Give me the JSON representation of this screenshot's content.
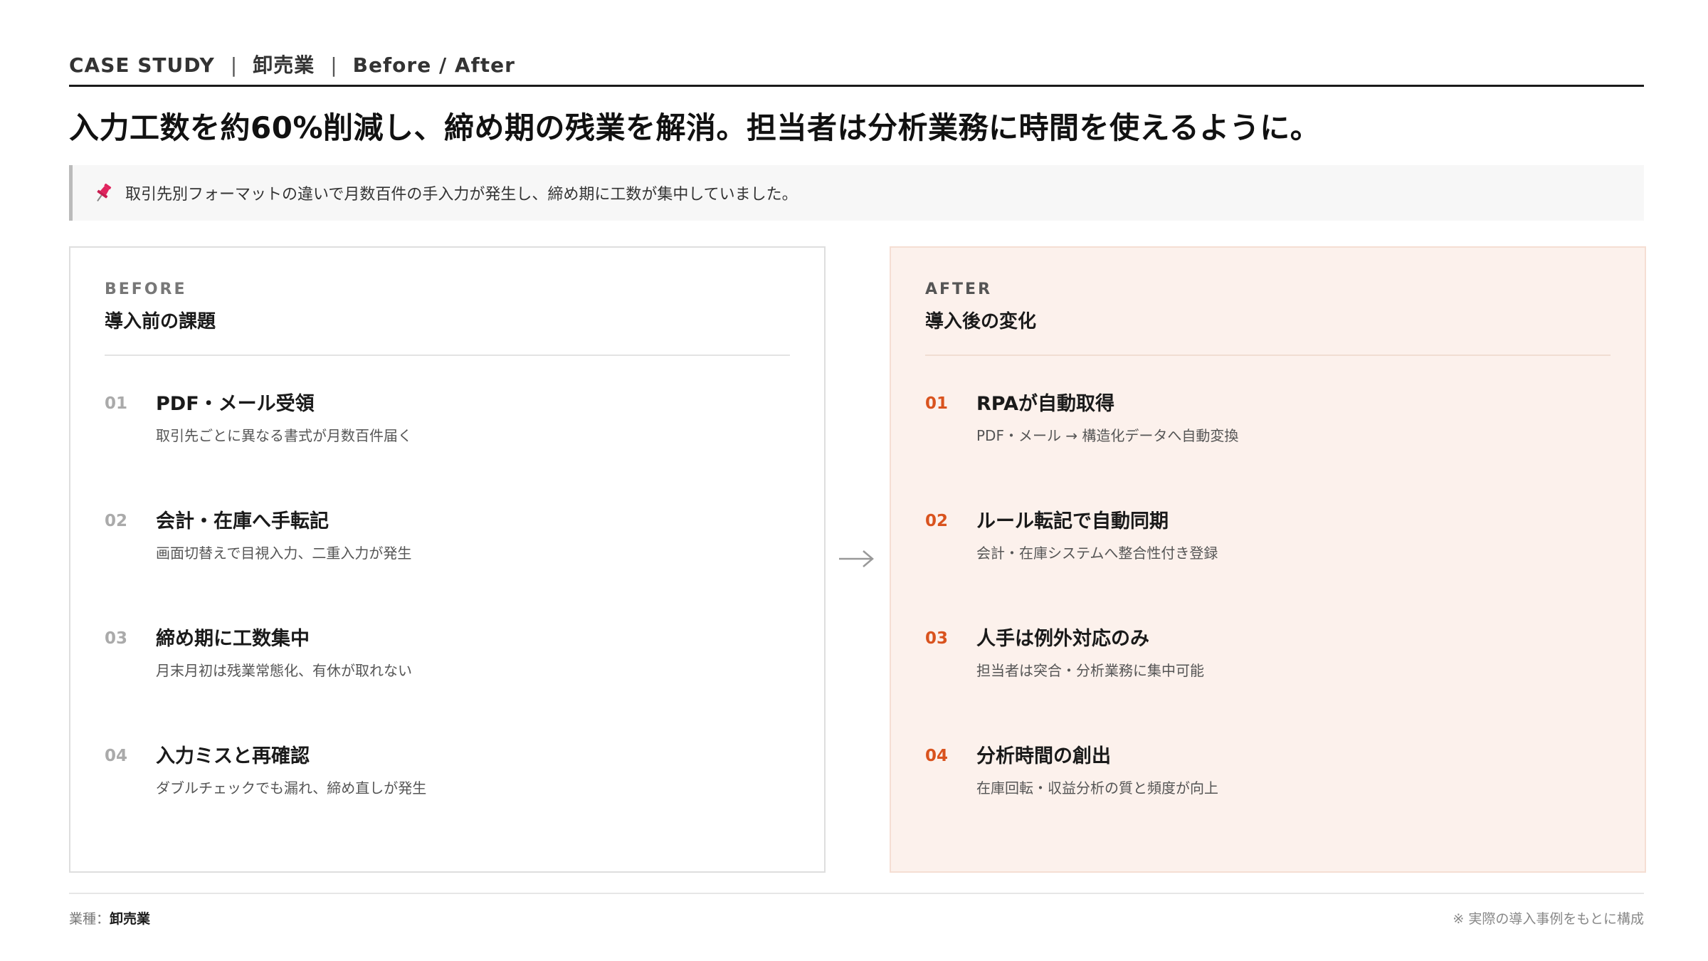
{
  "header": {
    "case_study": "CASE STUDY",
    "separator": "|",
    "industry": "卸売業",
    "section": "Before / After"
  },
  "headline": "入力工数を約60%削減し、締め期の残業を解消。担当者は分析業務に時間を使えるように。",
  "context": {
    "icon": "pushpin-icon",
    "text": "取引先別フォーマットの違いで月数百件の手入力が発生し、締め期に工数が集中していました。"
  },
  "before": {
    "kicker": "BEFORE",
    "title": "導入前の課題",
    "items": [
      {
        "num": "01",
        "title": "PDF・メール受領",
        "desc": "取引先ごとに異なる書式が月数百件届く"
      },
      {
        "num": "02",
        "title": "会計・在庫へ手転記",
        "desc": "画面切替えで目視入力、二重入力が発生"
      },
      {
        "num": "03",
        "title": "締め期に工数集中",
        "desc": "月末月初は残業常態化、有休が取れない"
      },
      {
        "num": "04",
        "title": "入力ミスと再確認",
        "desc": "ダブルチェックでも漏れ、締め直しが発生"
      }
    ]
  },
  "after": {
    "kicker": "AFTER",
    "title": "導入後の変化",
    "items": [
      {
        "num": "01",
        "title": "RPAが自動取得",
        "desc": "PDF・メール → 構造化データへ自動変換"
      },
      {
        "num": "02",
        "title": "ルール転記で自動同期",
        "desc": "会計・在庫システムへ整合性付き登録"
      },
      {
        "num": "03",
        "title": "人手は例外対応のみ",
        "desc": "担当者は突合・分析業務に集中可能"
      },
      {
        "num": "04",
        "title": "分析時間の創出",
        "desc": "在庫回転・収益分析の質と頻度が向上"
      }
    ]
  },
  "footer": {
    "industry_label": "業種：",
    "industry_value": "卸売業",
    "note": "※ 実際の導入事例をもとに構成"
  },
  "colors": {
    "accent": "#d9531e",
    "after_bg": "#fcf1ec",
    "pin": "#e0245e"
  }
}
